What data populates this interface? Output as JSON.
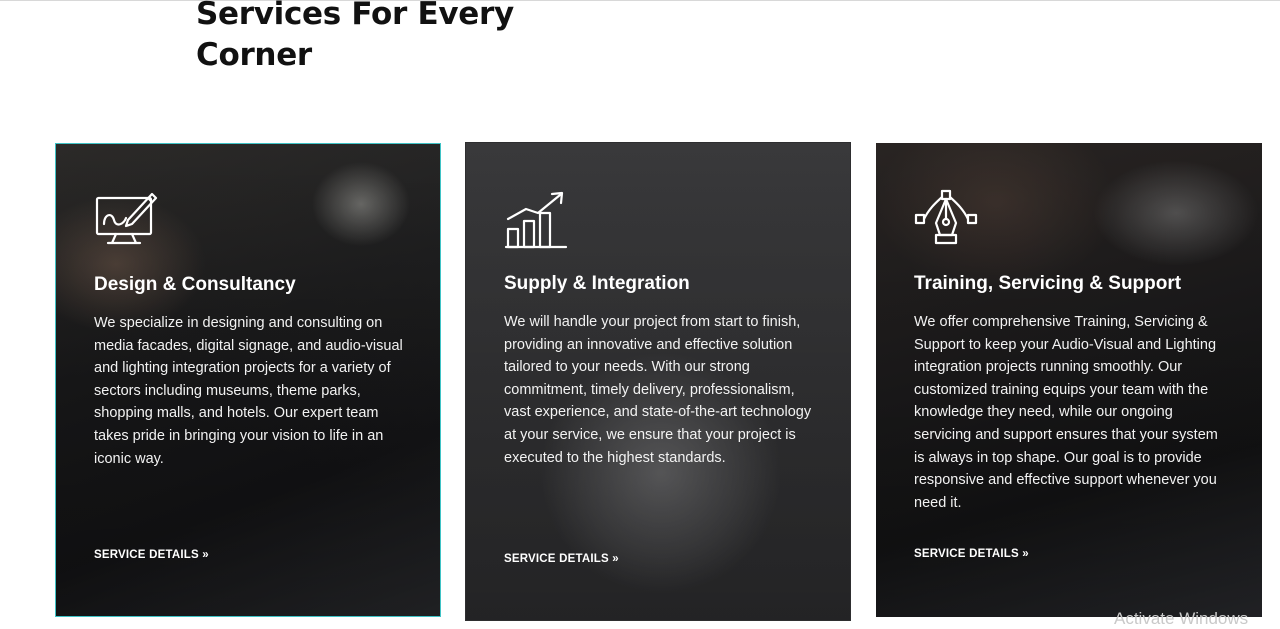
{
  "section": {
    "title": "Services For Every Corner"
  },
  "cards": [
    {
      "icon": "monitor-design-icon",
      "title": "Design & Consultancy",
      "description": "We specialize in designing and consulting on media facades, digital signage, and audio-visual and lighting integration projects for a variety of sectors including museums, theme parks, shopping malls, and hotels. Our expert team takes pride in bringing your vision to life in an iconic way.",
      "link": "SERVICE DETAILS »"
    },
    {
      "icon": "growth-chart-icon",
      "title": "Supply & Integration",
      "description": "We will handle your project from start to finish, providing an innovative and effective solution tailored to your needs. With our strong commitment, timely delivery, professionalism, vast experience, and state-of-the-art technology at your service, we ensure that your project is executed to the highest standards.",
      "link": "SERVICE DETAILS »"
    },
    {
      "icon": "pen-tool-icon",
      "title": "Training, Servicing & Support",
      "description": "We offer comprehensive Training, Servicing & Support to keep your Audio-Visual and Lighting integration projects running smoothly. Our customized training equips your team with the knowledge they need, while our ongoing servicing and support ensures that your system is always in top shape. Our goal is to provide responsive and effective support whenever you need it.",
      "link": "SERVICE DETAILS »"
    }
  ],
  "os_watermark": "Activate Windows",
  "colors": {
    "accent_border": "#3fc3c6",
    "title_text": "#111111",
    "card_text": "#ffffff"
  }
}
